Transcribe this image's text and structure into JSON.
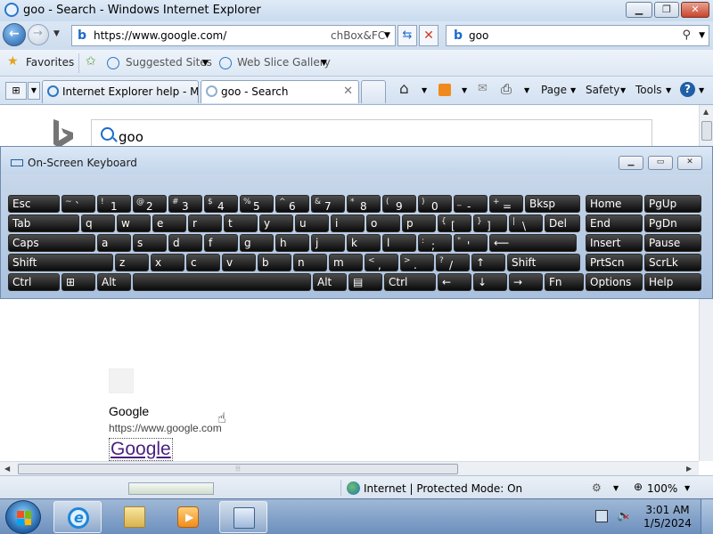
{
  "window": {
    "title": "goo - Search - Windows Internet Explorer"
  },
  "address_bar": {
    "url": "https://www.google.com/",
    "compat_text": "chBox&FC",
    "search_query": "goo"
  },
  "favorites_bar": {
    "favorites_label": "Favorites",
    "suggested_sites": "Suggested Sites",
    "web_slice_gallery": "Web Slice Gallery"
  },
  "tabs": [
    {
      "label": "Internet Explorer help - Mi..."
    },
    {
      "label": "goo - Search"
    }
  ],
  "command_bar": {
    "page": "Page",
    "safety": "Safety",
    "tools": "Tools"
  },
  "page": {
    "search_query": "goo",
    "result_name": "Google",
    "result_url": "https://www.google.com",
    "result_title": "Google"
  },
  "osk": {
    "title": "On-Screen Keyboard",
    "rows": [
      [
        {
          "l": "Esc"
        },
        {
          "s": "~",
          "m": "`"
        },
        {
          "s": "!",
          "m": "1"
        },
        {
          "s": "@",
          "m": "2"
        },
        {
          "s": "#",
          "m": "3"
        },
        {
          "s": "$",
          "m": "4"
        },
        {
          "s": "%",
          "m": "5"
        },
        {
          "s": "^",
          "m": "6"
        },
        {
          "s": "&",
          "m": "7"
        },
        {
          "s": "*",
          "m": "8"
        },
        {
          "s": "(",
          "m": "9"
        },
        {
          "s": ")",
          "m": "0"
        },
        {
          "s": "_",
          "m": "-"
        },
        {
          "s": "+",
          "m": "="
        },
        {
          "l": "Bksp"
        },
        {
          "l": "Home"
        },
        {
          "l": "PgUp"
        }
      ],
      [
        {
          "l": "Tab"
        },
        {
          "l": "q"
        },
        {
          "l": "w"
        },
        {
          "l": "e"
        },
        {
          "l": "r"
        },
        {
          "l": "t"
        },
        {
          "l": "y"
        },
        {
          "l": "u"
        },
        {
          "l": "i"
        },
        {
          "l": "o"
        },
        {
          "l": "p"
        },
        {
          "s": "{",
          "m": "["
        },
        {
          "s": "}",
          "m": "]"
        },
        {
          "s": "|",
          "m": "\\"
        },
        {
          "l": "Del"
        },
        {
          "l": "End"
        },
        {
          "l": "PgDn"
        }
      ],
      [
        {
          "l": "Caps"
        },
        {
          "l": "a"
        },
        {
          "l": "s"
        },
        {
          "l": "d"
        },
        {
          "l": "f"
        },
        {
          "l": "g"
        },
        {
          "l": "h"
        },
        {
          "l": "j"
        },
        {
          "l": "k"
        },
        {
          "l": "l"
        },
        {
          "s": ":",
          "m": ";"
        },
        {
          "s": "\"",
          "m": "'"
        },
        {
          "l": "⟵"
        },
        {
          "l": "Insert"
        },
        {
          "l": "Pause"
        }
      ],
      [
        {
          "l": "Shift"
        },
        {
          "l": "z"
        },
        {
          "l": "x"
        },
        {
          "l": "c"
        },
        {
          "l": "v"
        },
        {
          "l": "b"
        },
        {
          "l": "n"
        },
        {
          "l": "m"
        },
        {
          "s": "<",
          "m": ","
        },
        {
          "s": ">",
          "m": "."
        },
        {
          "s": "?",
          "m": "/"
        },
        {
          "l": "↑"
        },
        {
          "l": "Shift"
        },
        {
          "l": "PrtScn"
        },
        {
          "l": "ScrLk"
        }
      ],
      [
        {
          "l": "Ctrl"
        },
        {
          "l": "⊞"
        },
        {
          "l": "Alt"
        },
        {
          "l": ""
        },
        {
          "l": "Alt"
        },
        {
          "l": "▤"
        },
        {
          "l": "Ctrl"
        },
        {
          "l": "←"
        },
        {
          "l": "↓"
        },
        {
          "l": "→"
        },
        {
          "l": "Fn"
        },
        {
          "l": "Options"
        },
        {
          "l": "Help"
        }
      ]
    ]
  },
  "status_bar": {
    "zone": "Internet | Protected Mode: On",
    "zoom": "100%"
  },
  "taskbar": {
    "time": "3:01 AM",
    "date": "1/5/2024"
  }
}
